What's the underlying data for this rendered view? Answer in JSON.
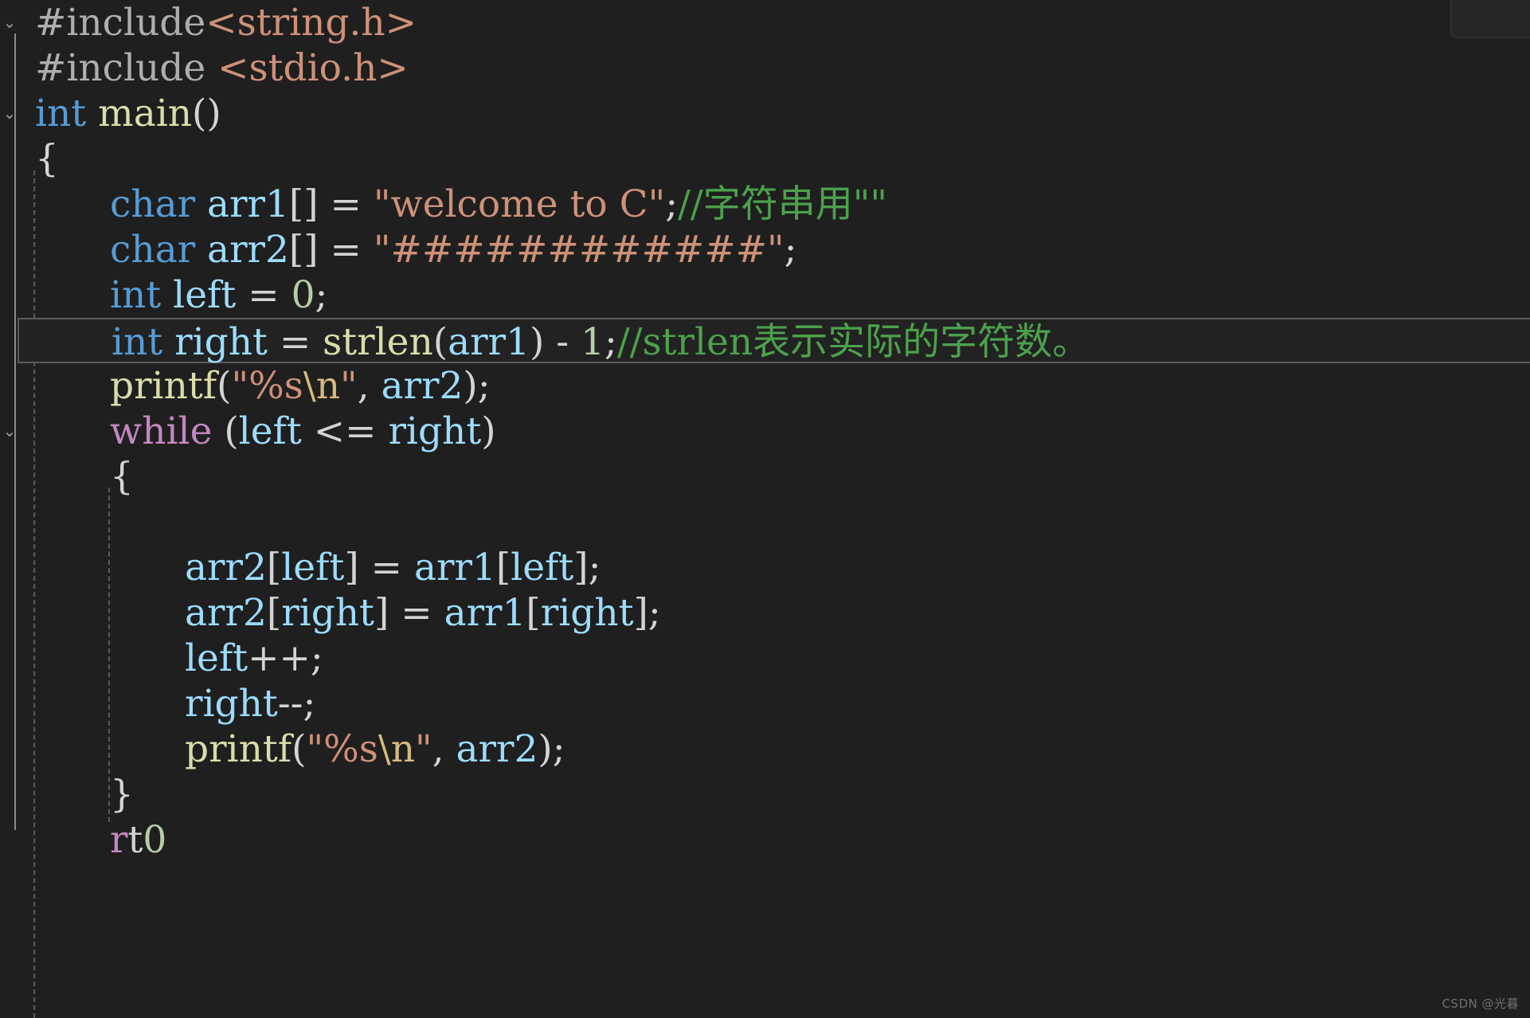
{
  "editor": {
    "theme": "dark",
    "background": "#1f1f1f",
    "language": "c",
    "highlighted_line_index": 6,
    "colors": {
      "keyword": "#569cd6",
      "keyword_control": "#c586c0",
      "identifier": "#9cdcfe",
      "function": "#dcdcaa",
      "string": "#ce9178",
      "number": "#b5cea8",
      "punctuation": "#d4d4d4",
      "preprocessor": "#aeaeae",
      "comment": "#4ca14c",
      "escape": "#d7ba7d",
      "highlight_border": "#5a5a5a"
    }
  },
  "minimap": {
    "name": "minimap-overview"
  },
  "watermark": {
    "text": "CSDN @光暮"
  },
  "code": {
    "lines": [
      {
        "fold": "chevron-down",
        "indent": 0,
        "tokens": [
          {
            "t": "pre",
            "v": "#include"
          },
          {
            "t": "str",
            "v": "<string.h>"
          }
        ]
      },
      {
        "fold": "",
        "indent": 0,
        "tokens": [
          {
            "t": "pre",
            "v": "#include "
          },
          {
            "t": "str",
            "v": "<stdio.h>"
          }
        ]
      },
      {
        "fold": "chevron-down",
        "indent": 0,
        "tokens": [
          {
            "t": "kw",
            "v": "int"
          },
          {
            "t": "punc",
            "v": " "
          },
          {
            "t": "fn",
            "v": "main"
          },
          {
            "t": "punc",
            "v": "()"
          }
        ]
      },
      {
        "fold": "",
        "indent": 0,
        "tokens": [
          {
            "t": "punc",
            "v": "{"
          }
        ]
      },
      {
        "fold": "",
        "indent": 1,
        "tokens": [
          {
            "t": "kw",
            "v": "char"
          },
          {
            "t": "punc",
            "v": " "
          },
          {
            "t": "ident",
            "v": "arr1"
          },
          {
            "t": "punc",
            "v": "[] = "
          },
          {
            "t": "str",
            "v": "\"welcome to C\""
          },
          {
            "t": "punc",
            "v": ";"
          },
          {
            "t": "cmt",
            "v": "//字符串用\"\""
          }
        ]
      },
      {
        "fold": "",
        "indent": 1,
        "tokens": [
          {
            "t": "kw",
            "v": "char"
          },
          {
            "t": "punc",
            "v": " "
          },
          {
            "t": "ident",
            "v": "arr2"
          },
          {
            "t": "punc",
            "v": "[] = "
          },
          {
            "t": "str",
            "v": "\"############\""
          },
          {
            "t": "punc",
            "v": ";"
          }
        ]
      },
      {
        "fold": "",
        "indent": 1,
        "tokens": [
          {
            "t": "kw",
            "v": "int"
          },
          {
            "t": "punc",
            "v": " "
          },
          {
            "t": "ident",
            "v": "left"
          },
          {
            "t": "punc",
            "v": " = "
          },
          {
            "t": "num",
            "v": "0"
          },
          {
            "t": "punc",
            "v": ";"
          }
        ]
      },
      {
        "fold": "",
        "indent": 1,
        "highlight": true,
        "tokens": [
          {
            "t": "kw",
            "v": "int"
          },
          {
            "t": "punc",
            "v": " "
          },
          {
            "t": "ident",
            "v": "right"
          },
          {
            "t": "punc",
            "v": " = "
          },
          {
            "t": "fn",
            "v": "strlen"
          },
          {
            "t": "punc",
            "v": "("
          },
          {
            "t": "ident",
            "v": "arr1"
          },
          {
            "t": "punc",
            "v": ") - "
          },
          {
            "t": "num",
            "v": "1"
          },
          {
            "t": "punc",
            "v": ";"
          },
          {
            "t": "cmt",
            "v": "//strlen表示实际的字符数。"
          }
        ]
      },
      {
        "fold": "",
        "indent": 1,
        "tokens": [
          {
            "t": "fn",
            "v": "printf"
          },
          {
            "t": "punc",
            "v": "("
          },
          {
            "t": "str",
            "v": "\"%s"
          },
          {
            "t": "esc",
            "v": "\\n"
          },
          {
            "t": "str",
            "v": "\""
          },
          {
            "t": "punc",
            "v": ", "
          },
          {
            "t": "ident",
            "v": "arr2"
          },
          {
            "t": "punc",
            "v": ");"
          }
        ]
      },
      {
        "fold": "chevron-down",
        "indent": 1,
        "tokens": [
          {
            "t": "kw2",
            "v": "while"
          },
          {
            "t": "punc",
            "v": " ("
          },
          {
            "t": "ident",
            "v": "left"
          },
          {
            "t": "punc",
            "v": " <= "
          },
          {
            "t": "ident",
            "v": "right"
          },
          {
            "t": "punc",
            "v": ")"
          }
        ]
      },
      {
        "fold": "",
        "indent": 1,
        "tokens": [
          {
            "t": "punc",
            "v": "{"
          }
        ]
      },
      {
        "fold": "",
        "indent": 1,
        "tokens": []
      },
      {
        "fold": "",
        "indent": 2,
        "tokens": [
          {
            "t": "ident",
            "v": "arr2"
          },
          {
            "t": "punc",
            "v": "["
          },
          {
            "t": "ident",
            "v": "left"
          },
          {
            "t": "punc",
            "v": "] = "
          },
          {
            "t": "ident",
            "v": "arr1"
          },
          {
            "t": "punc",
            "v": "["
          },
          {
            "t": "ident",
            "v": "left"
          },
          {
            "t": "punc",
            "v": "];"
          }
        ]
      },
      {
        "fold": "",
        "indent": 2,
        "tokens": [
          {
            "t": "ident",
            "v": "arr2"
          },
          {
            "t": "punc",
            "v": "["
          },
          {
            "t": "ident",
            "v": "right"
          },
          {
            "t": "punc",
            "v": "] = "
          },
          {
            "t": "ident",
            "v": "arr1"
          },
          {
            "t": "punc",
            "v": "["
          },
          {
            "t": "ident",
            "v": "right"
          },
          {
            "t": "punc",
            "v": "];"
          }
        ]
      },
      {
        "fold": "",
        "indent": 2,
        "tokens": [
          {
            "t": "ident",
            "v": "left"
          },
          {
            "t": "punc",
            "v": "++;"
          }
        ]
      },
      {
        "fold": "",
        "indent": 2,
        "tokens": [
          {
            "t": "ident",
            "v": "right"
          },
          {
            "t": "punc",
            "v": "--;"
          }
        ]
      },
      {
        "fold": "",
        "indent": 2,
        "tokens": [
          {
            "t": "fn",
            "v": "printf"
          },
          {
            "t": "punc",
            "v": "("
          },
          {
            "t": "str",
            "v": "\"%s"
          },
          {
            "t": "esc",
            "v": "\\n"
          },
          {
            "t": "str",
            "v": "\""
          },
          {
            "t": "punc",
            "v": ", "
          },
          {
            "t": "ident",
            "v": "arr2"
          },
          {
            "t": "punc",
            "v": ");"
          }
        ]
      },
      {
        "fold": "",
        "indent": 1,
        "tokens": [
          {
            "t": "punc",
            "v": "}"
          }
        ]
      },
      {
        "fold": "",
        "indent": 1,
        "tokens": [
          {
            "t": "kw2",
            "v": "r"
          },
          {
            "t": "punc",
            "v": "t"
          },
          {
            "t": "num",
            "v": "0"
          }
        ]
      }
    ]
  }
}
